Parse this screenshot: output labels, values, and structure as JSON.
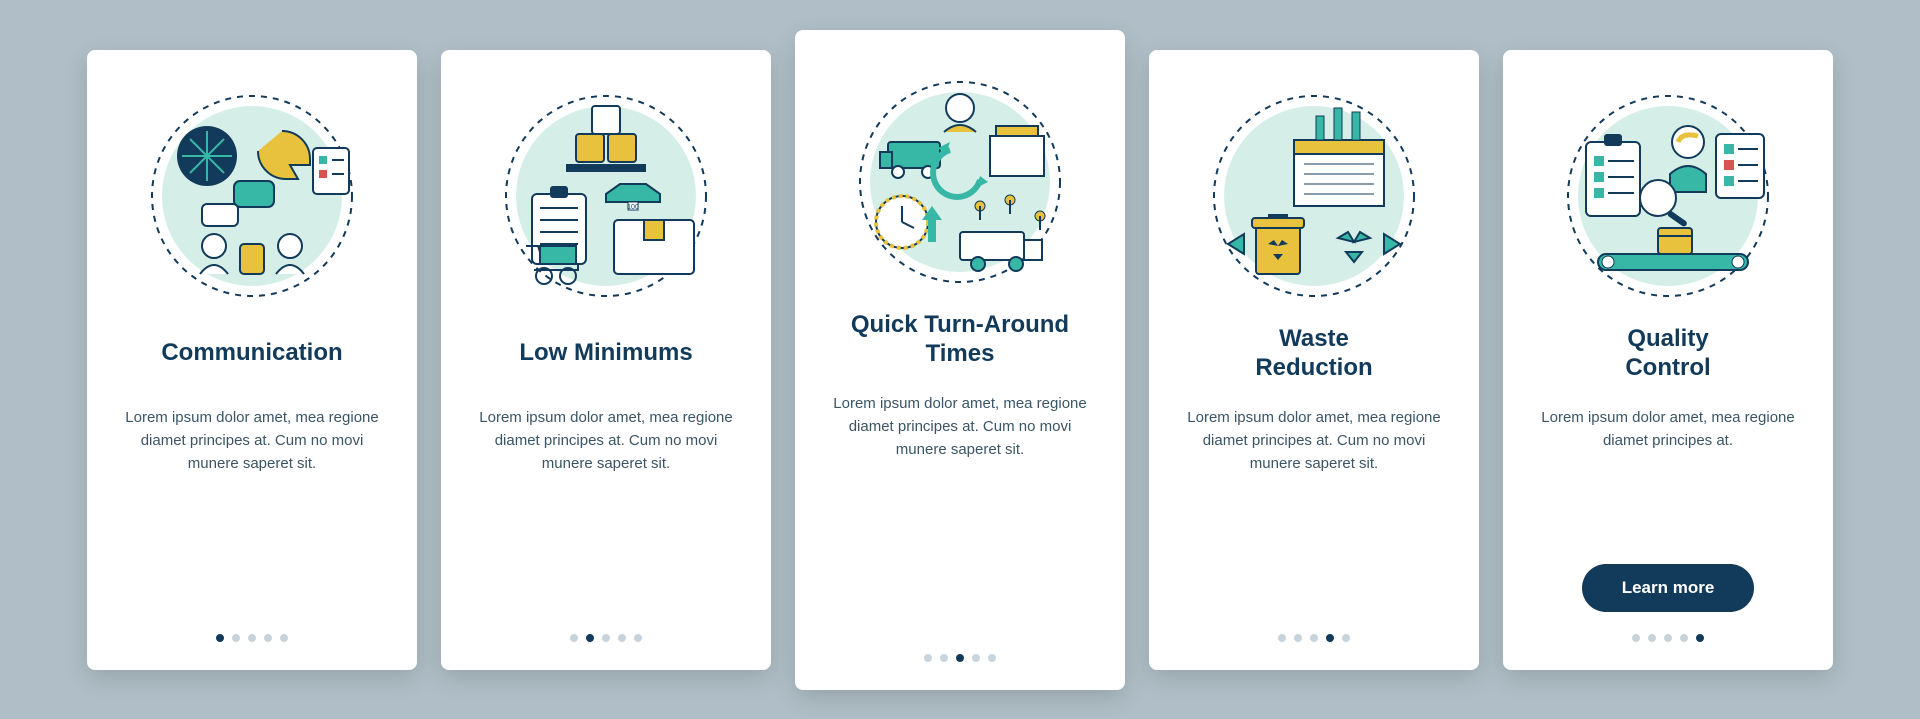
{
  "colors": {
    "text_dark": "#123a5a",
    "text_body": "#3a5566",
    "bg": "#b0bfc7",
    "accent_teal": "#37b7a5",
    "accent_mint": "#bfe9df",
    "accent_yellow": "#e8c23d",
    "cta_bg": "#123a5a"
  },
  "cards": [
    {
      "heading": "Communication",
      "body": "Lorem ipsum dolor amet, mea regione diamet principes at. Cum no movi munere saperet sit.",
      "icon": "communication-icon",
      "active_dot": 0,
      "featured": false,
      "has_cta": false
    },
    {
      "heading": "Low Minimums",
      "body": "Lorem ipsum dolor amet, mea regione diamet principes at. Cum no movi munere saperet sit.",
      "icon": "low-minimums-icon",
      "active_dot": 1,
      "featured": false,
      "has_cta": false
    },
    {
      "heading": "Quick Turn-Around\nTimes",
      "body": "Lorem ipsum dolor amet, mea regione diamet principes at. Cum no movi munere saperet sit.",
      "icon": "turnaround-icon",
      "active_dot": 2,
      "featured": true,
      "has_cta": false
    },
    {
      "heading": "Waste\nReduction",
      "body": "Lorem ipsum dolor amet, mea regione diamet principes at. Cum no movi munere saperet sit.",
      "icon": "waste-reduction-icon",
      "active_dot": 3,
      "featured": false,
      "has_cta": false
    },
    {
      "heading": "Quality\nControl",
      "body": "Lorem ipsum dolor amet, mea regione diamet principes at.",
      "icon": "quality-control-icon",
      "active_dot": 4,
      "featured": false,
      "has_cta": true
    }
  ],
  "dot_count": 5,
  "cta_label": "Learn more"
}
